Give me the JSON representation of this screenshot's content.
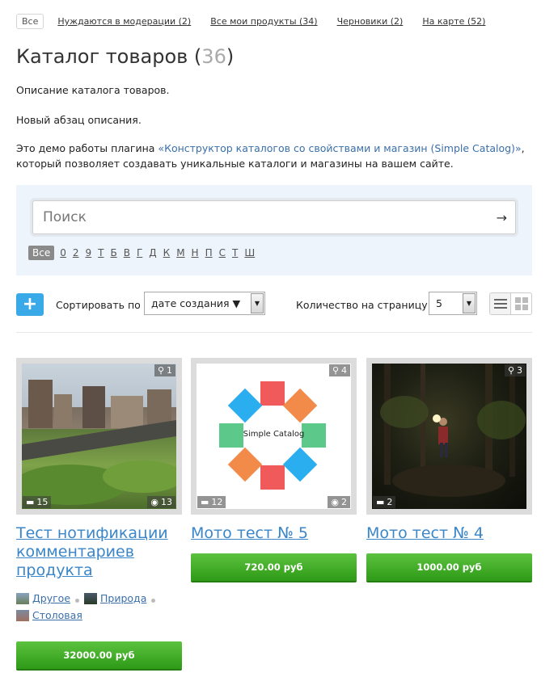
{
  "filters": {
    "all_label": "Все",
    "links": [
      "Нуждаются в модерации (2)",
      "Все мои продукты (34)",
      "Черновики (2)",
      "На карте (52)"
    ]
  },
  "page": {
    "title": "Каталог товаров",
    "title_count_open": "(",
    "title_count": "36",
    "title_count_close": ")",
    "desc1": "Описание каталога товаров.",
    "desc2": "Новый абзац описания.",
    "desc3_prefix": "Это демо работы плагина ",
    "desc3_link": "«Конструктор каталогов со свойствами и магазин (Simple Catalog)»",
    "desc3_suffix": ",",
    "desc3_line2": "который позволяет создавать уникальные каталоги и магазины на вашем сайте."
  },
  "search": {
    "placeholder": "Поиск",
    "submit_icon": "→",
    "letters_all": "Все",
    "letters": [
      "0",
      "2",
      "9",
      "Т",
      "Б",
      "В",
      "Г",
      "Д",
      "К",
      "М",
      "Н",
      "П",
      "С",
      "Т",
      "Ш"
    ]
  },
  "toolbar": {
    "add_label": "+",
    "sort_label": "Сортировать по",
    "sort_value": "дате создания ▼",
    "perpage_label": "Количество на страницу",
    "perpage_value": "5",
    "view_list_icon": "list-view-icon",
    "view_grid_icon": "grid-view-icon"
  },
  "products": [
    {
      "name": "Тест нотификации комментариев продукта",
      "map_count": "1",
      "comments": "15",
      "views": "13",
      "price": "32000.00 руб",
      "categories": [
        "Другое",
        "Природа",
        "Столовая"
      ]
    },
    {
      "name": "Мото тест № 5",
      "map_count": "4",
      "comments": "12",
      "views": "2",
      "price": "720.00 руб",
      "logo_text": "Simple Catalog"
    },
    {
      "name": "Мото тест № 4",
      "map_count": "3",
      "comments": "2",
      "price": "1000.00 руб"
    }
  ]
}
